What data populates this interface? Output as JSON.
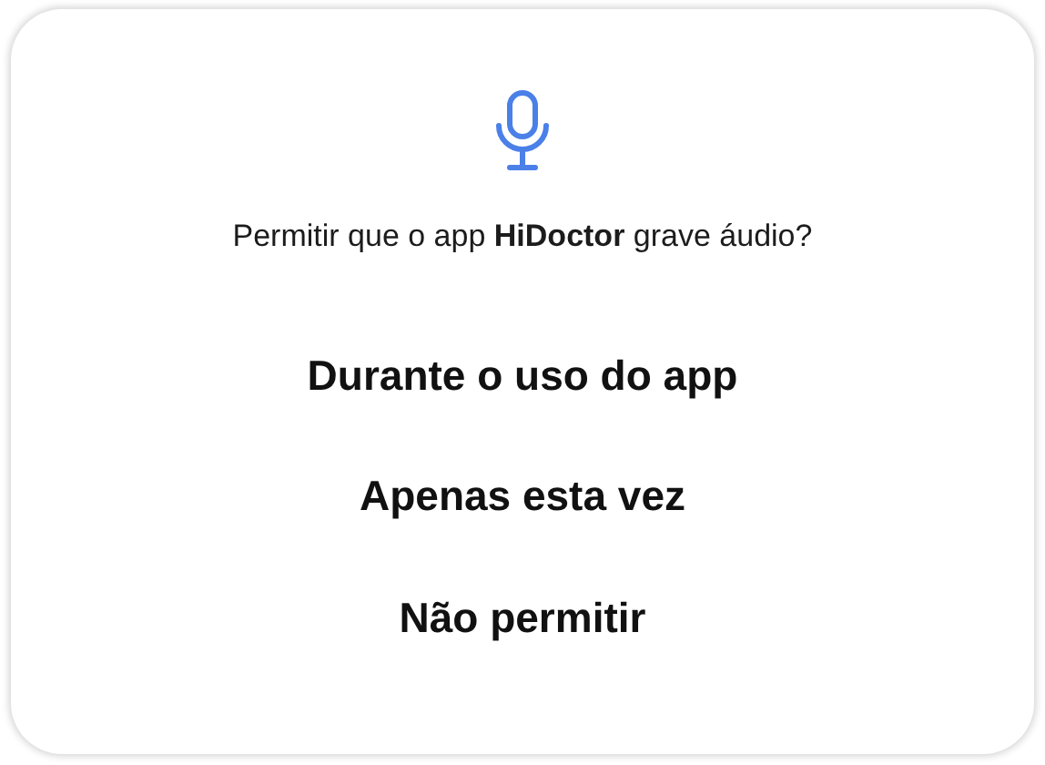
{
  "dialog": {
    "message": "Permitir que o app **HiDoctor** grave áudio?",
    "options": [
      {
        "label": "Durante o uso do app"
      },
      {
        "label": "Apenas esta vez"
      },
      {
        "label": "Não permitir"
      }
    ]
  }
}
